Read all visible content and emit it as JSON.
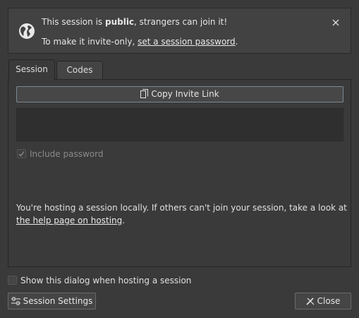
{
  "banner": {
    "line1_prefix": "This session is ",
    "line1_bold": "public",
    "line1_suffix": ", strangers can join it!",
    "line2_prefix": "To make it invite-only, ",
    "line2_link": "set a session password",
    "line2_suffix": ".",
    "icon": "globe-icon",
    "close_icon": "close-icon"
  },
  "tabs": [
    {
      "label": "Session",
      "active": true
    },
    {
      "label": "Codes",
      "active": false
    }
  ],
  "session": {
    "copy_button_label": "Copy Invite Link",
    "copy_icon": "copy-icon",
    "invite_link_value": "",
    "include_password_label": "Include password",
    "include_password_checked": true,
    "include_password_enabled": false,
    "info_prefix": "You're hosting a session locally. If others can't join your session, take a look at ",
    "info_link": "the help page on hosting",
    "info_suffix": "."
  },
  "footer": {
    "show_dialog_label": "Show this dialog when hosting a session",
    "show_dialog_checked": false,
    "settings_button_label": "Session Settings",
    "settings_icon": "sliders-icon",
    "close_button_label": "Close",
    "close_button_icon": "close-tool-icon"
  },
  "colors": {
    "background": "#3a3a3a",
    "banner_background": "#424242",
    "focus_border": "#7a8892",
    "text": "#dcdcdc"
  }
}
